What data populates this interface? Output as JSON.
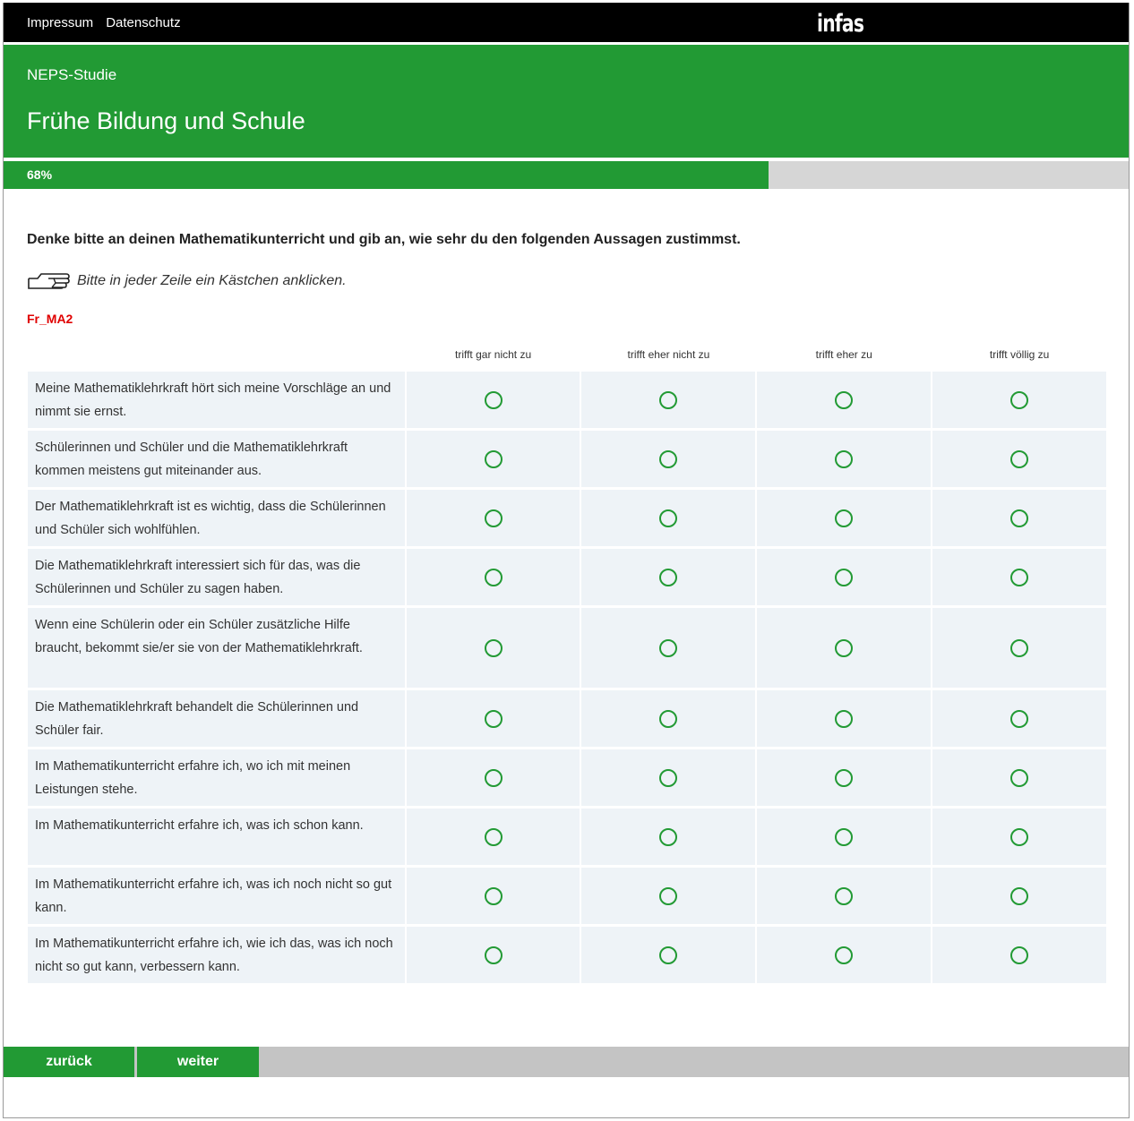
{
  "topbar": {
    "links": [
      "Impressum",
      "Datenschutz"
    ],
    "logo": "infas"
  },
  "header": {
    "study": "NEPS-Studie",
    "title": "Frühe Bildung und Schule"
  },
  "progress": {
    "label": "68%",
    "value": 0.68
  },
  "question": {
    "text": "Denke bitte an deinen Mathematikunterricht und gib an, wie sehr du den folgenden Aussagen zustimmst.",
    "instruction": "Bitte in jeder Zeile ein Kästchen anklicken.",
    "code": "Fr_MA2"
  },
  "scale": [
    "trifft gar nicht zu",
    "trifft eher nicht zu",
    "trifft eher zu",
    "trifft völlig zu"
  ],
  "items": [
    "Meine Mathematiklehrkraft hört sich meine Vorschläge an und nimmt sie ernst.",
    "Schülerinnen und Schüler und die Mathematiklehrkraft kommen meistens gut miteinander aus.",
    "Der Mathematiklehrkraft ist es wichtig, dass die Schülerinnen und Schüler sich wohlfühlen.",
    "Die Mathematiklehrkraft interessiert sich für das, was die Schülerinnen und Schüler zu sagen haben.",
    "Wenn eine Schülerin oder ein Schüler zusätzliche Hilfe braucht, bekommt sie/er sie von der Mathematiklehrkraft.",
    "Die Mathematiklehrkraft behandelt die Schülerinnen und Schüler fair.",
    "Im Mathematikunterricht erfahre ich, wo ich mit meinen Leistungen stehe.",
    "Im Mathematikunterricht erfahre ich, was ich schon kann.",
    "Im Mathematikunterricht erfahre ich, was ich noch nicht so gut kann.",
    "Im Mathematikunterricht erfahre ich, wie ich das, was ich noch nicht so gut kann, verbessern kann."
  ],
  "nav": {
    "back": "zurück",
    "next": "weiter"
  },
  "colors": {
    "brand": "#229a34",
    "row_bg": "#eef3f7",
    "code": "#e00000"
  }
}
